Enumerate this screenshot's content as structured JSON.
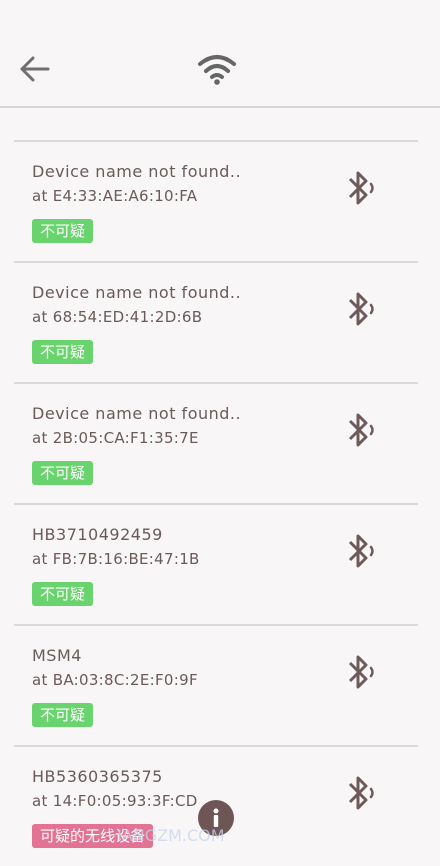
{
  "colors": {
    "background": "#f8f6f6",
    "text": "#6b5a5a",
    "badge_safe": "#69d36d",
    "badge_suspicious": "#e27394"
  },
  "header": {
    "back_icon": "arrow-left-icon",
    "center_icon": "wifi-icon"
  },
  "devices": [
    {
      "name": "Device name not found..",
      "mac": "at E4:33:AE:A6:10:FA",
      "badge": "不可疑"
    },
    {
      "name": "Device name not found..",
      "mac": "at 68:54:ED:41:2D:6B",
      "badge": "不可疑"
    },
    {
      "name": "Device name not found..",
      "mac": "at 2B:05:CA:F1:35:7E",
      "badge": "不可疑"
    },
    {
      "name": "HB3710492459",
      "mac": "at FB:7B:16:BE:47:1B",
      "badge": "不可疑"
    },
    {
      "name": "MSM4",
      "mac": "at BA:03:8C:2E:F0:9F",
      "badge": "不可疑"
    },
    {
      "name": "HB5360365375",
      "mac": "at 14:F0:05:93:3F:CD",
      "badge": "可疑的无线设备"
    }
  ],
  "watermark": "·IANGZM.COM"
}
